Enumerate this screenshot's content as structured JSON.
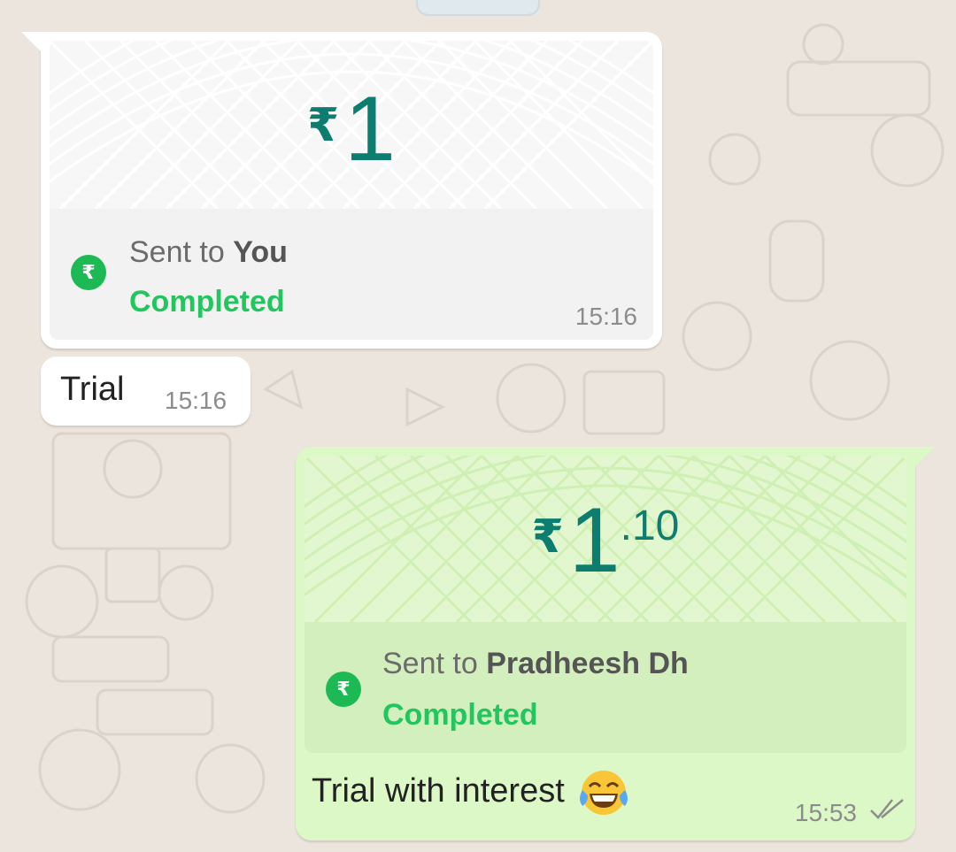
{
  "messages": {
    "payment_received": {
      "currency_symbol": "₹",
      "amount_int": "1",
      "sent_to_prefix": "Sent to",
      "recipient": "You",
      "status": "Completed",
      "time": "15:16"
    },
    "text_message": {
      "text": "Trial",
      "time": "15:16"
    },
    "payment_sent": {
      "currency_symbol": "₹",
      "amount_int": "1",
      "amount_dec": ".10",
      "sent_to_prefix": "Sent to",
      "recipient": "Pradheesh Dh",
      "status": "Completed",
      "caption": "Trial with interest",
      "caption_emoji": "face-with-tears-of-joy",
      "time": "15:53",
      "read_receipt": "double-check-icon"
    }
  },
  "colors": {
    "chat_background": "#ece5dd",
    "incoming_bubble": "#ffffff",
    "outgoing_bubble": "#dcf8c6",
    "amount_color": "#0c7d6e",
    "status_green": "#22c55e",
    "rupee_badge": "#1db954"
  }
}
